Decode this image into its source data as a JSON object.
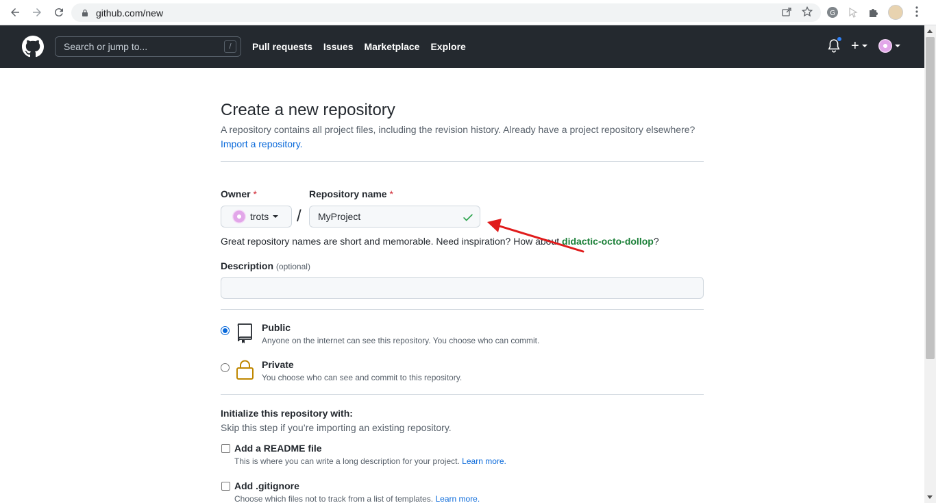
{
  "browser": {
    "url": "github.com/new"
  },
  "header": {
    "search_placeholder": "Search or jump to...",
    "search_shortcut": "/",
    "nav": [
      "Pull requests",
      "Issues",
      "Marketplace",
      "Explore"
    ],
    "plus_label": "+"
  },
  "page": {
    "title": "Create a new repository",
    "subtitle": "A repository contains all project files, including the revision history. Already have a project repository elsewhere?",
    "import_link": "Import a repository."
  },
  "form": {
    "owner_label": "Owner",
    "required_mark": "*",
    "owner_value": "trots",
    "separator": "/",
    "repo_label": "Repository name",
    "repo_value": "MyProject",
    "hint_prefix": "Great repository names are short and memorable. Need inspiration? How about",
    "hint_suggestion": "didactic-octo-dollop",
    "hint_suffix": "?",
    "description_label": "Description",
    "description_optional": "(optional)",
    "description_value": ""
  },
  "visibility": {
    "public_title": "Public",
    "public_desc": "Anyone on the internet can see this repository. You choose who can commit.",
    "private_title": "Private",
    "private_desc": "You choose who can see and commit to this repository.",
    "selected": "public"
  },
  "init": {
    "title": "Initialize this repository with:",
    "subtitle": "Skip this step if you’re importing an existing repository.",
    "readme_title": "Add a README file",
    "readme_desc": "This is where you can write a long description for your project.",
    "gitignore_title": "Add .gitignore",
    "gitignore_desc": "Choose which files not to track from a list of templates.",
    "learn_more": "Learn more."
  },
  "colors": {
    "header_bg": "#24292f",
    "link_blue": "#0969da",
    "suggest_green": "#1a7f37",
    "check_green": "#2da44e",
    "annotation_red": "#e01b1b",
    "lock_gold": "#bf8700"
  }
}
